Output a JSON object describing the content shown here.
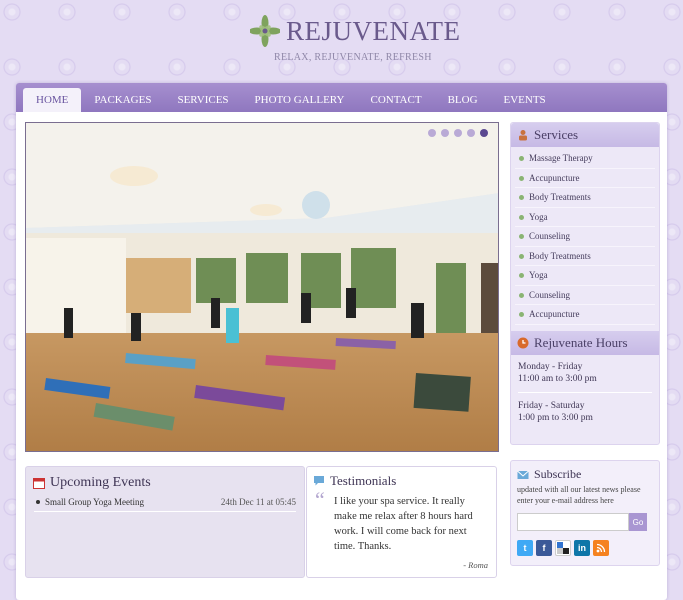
{
  "site": {
    "name": "REJUVENATE",
    "tagline": "RELAX, REJUVENATE, REFRESH"
  },
  "nav": {
    "items": [
      {
        "label": "HOME",
        "active": true
      },
      {
        "label": "PACKAGES"
      },
      {
        "label": "SERVICES"
      },
      {
        "label": "PHOTO GALLERY"
      },
      {
        "label": "CONTACT"
      },
      {
        "label": "BLOG"
      },
      {
        "label": "EVENTS"
      }
    ]
  },
  "slider": {
    "dot_count": 5,
    "active_dot": 5
  },
  "services": {
    "title": "Services",
    "items": [
      "Massage Therapy",
      "Accupuncture",
      "Body Treatments",
      "Yoga",
      "Counseling",
      "Body Treatments",
      "Yoga",
      "Counseling",
      "Accupuncture"
    ]
  },
  "hours": {
    "title": "Rejuvenate Hours",
    "weekday_days": "Monday - Friday",
    "weekday_time": "11:00 am to 3:00 pm",
    "weekend_days": "Friday - Saturday",
    "weekend_time": "1:00 pm to 3:00 pm"
  },
  "events": {
    "title": "Upcoming Events",
    "items": [
      {
        "name": "Small Group Yoga Meeting",
        "date": "24th Dec 11 at 05:45"
      }
    ]
  },
  "testimonials": {
    "title": "Testimonials",
    "quote": "I like your spa service. It really make me relax after 8 hours hard work. I will come back for next time. Thanks.",
    "author": "- Roma"
  },
  "subscribe": {
    "title": "Subscribe",
    "description": "updated with all our latest news please enter your e-mail address here",
    "input_value": "",
    "button_label": "Go",
    "socials": [
      {
        "name": "twitter-icon",
        "glyph": "t",
        "color": "#3fa9f5"
      },
      {
        "name": "facebook-icon",
        "glyph": "f",
        "color": "#3b5998"
      },
      {
        "name": "delicious-icon",
        "glyph": "",
        "color": "#3274d1"
      },
      {
        "name": "linkedin-icon",
        "glyph": "in",
        "color": "#0e76a8"
      },
      {
        "name": "rss-icon",
        "glyph": "",
        "color": "#f58220"
      }
    ]
  },
  "colors": {
    "accent": "#8f77bf",
    "background": "#e4dcf3"
  }
}
